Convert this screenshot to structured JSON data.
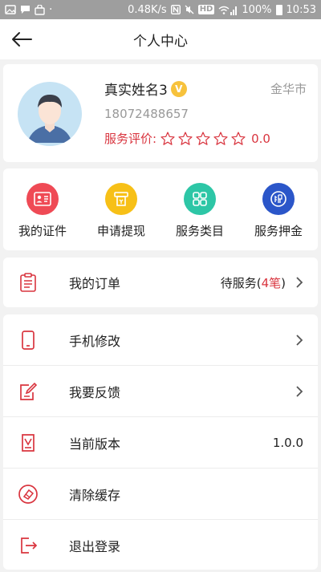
{
  "status_bar": {
    "speed": "0.48K/s",
    "hd": "HD",
    "battery": "100%",
    "time": "10:53"
  },
  "nav": {
    "title": "个人中心",
    "back_icon": "arrow-left-icon"
  },
  "profile": {
    "name": "真实姓名3",
    "verified_badge": "V",
    "city": "金华市",
    "phone": "18072488657",
    "rating_label": "服务评价:",
    "rating_value": "0.0",
    "stars_filled": 0,
    "stars_total": 5
  },
  "quick_actions": [
    {
      "label": "我的证件",
      "icon": "id-card-icon",
      "color": "#ef4a55"
    },
    {
      "label": "申请提现",
      "icon": "withdraw-icon",
      "color": "#f7c017"
    },
    {
      "label": "服务类目",
      "icon": "category-grid-icon",
      "color": "#2dc6a6"
    },
    {
      "label": "服务押金",
      "icon": "deposit-icon",
      "color": "#2b56c9"
    }
  ],
  "orders": {
    "label": "我的订单",
    "status_prefix": "待服务(",
    "count": "4笔",
    "status_suffix": ")"
  },
  "menu": [
    {
      "label": "手机修改",
      "icon": "phone-icon"
    },
    {
      "label": "我要反馈",
      "icon": "feedback-edit-icon"
    },
    {
      "label": "当前版本",
      "icon": "version-icon",
      "value": "1.0.0"
    },
    {
      "label": "清除缓存",
      "icon": "clear-cache-icon"
    },
    {
      "label": "退出登录",
      "icon": "logout-icon"
    }
  ],
  "colors": {
    "accent": "#d9353f",
    "muted": "#999999"
  }
}
